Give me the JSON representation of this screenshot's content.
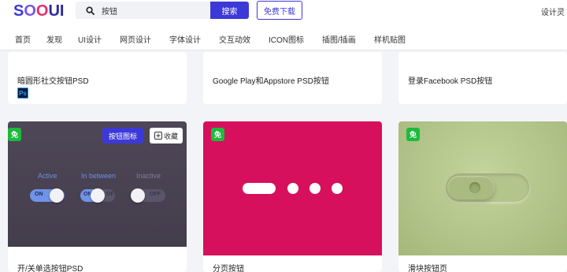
{
  "header": {
    "logo": [
      "S",
      "O",
      "O",
      "UI"
    ],
    "search": {
      "placeholder": "搜索",
      "value": "按钮",
      "button_label": "搜索"
    },
    "free_download_label": "免费下载",
    "top_right_label": "设计灵"
  },
  "nav": {
    "items": [
      "首页",
      "发现",
      "UI设计",
      "网页设计",
      "字体设计",
      "交互动效",
      "ICON图标",
      "插图/插画",
      "样机贴图"
    ]
  },
  "cards_top": [
    {
      "title": "暗圆形社交按钮PSD",
      "badge": "Ps"
    },
    {
      "title": "Google Play和Appstore PSD按钮"
    },
    {
      "title": "登录Facebook PSD按钮"
    }
  ],
  "cards_bottom": [
    {
      "title": "开/关单选按钮PSD",
      "free_badge": "免",
      "tag_label": "按钮图标",
      "collect_label": "收藏",
      "toggle_labels": [
        "Active",
        "In between",
        "Inactive"
      ],
      "toggle_texts": [
        "ON",
        "ON",
        "OFF"
      ],
      "toggle_state_text_right": "OF",
      "toggle_values": [
        "on",
        "between",
        "off"
      ]
    },
    {
      "title": "分页按钮",
      "free_badge": "免"
    },
    {
      "title": "滑块按钮页",
      "free_badge": "免"
    }
  ],
  "colors": {
    "accent": "#3d39d8",
    "free_badge": "#1dba3c",
    "card2_bg": "#d6105c",
    "card1_bg": "#4a4353",
    "card3_bg": "#b3c58a"
  },
  "icons": {
    "search": "search-icon",
    "collect": "plus-square-icon",
    "ps": "photoshop-icon"
  }
}
